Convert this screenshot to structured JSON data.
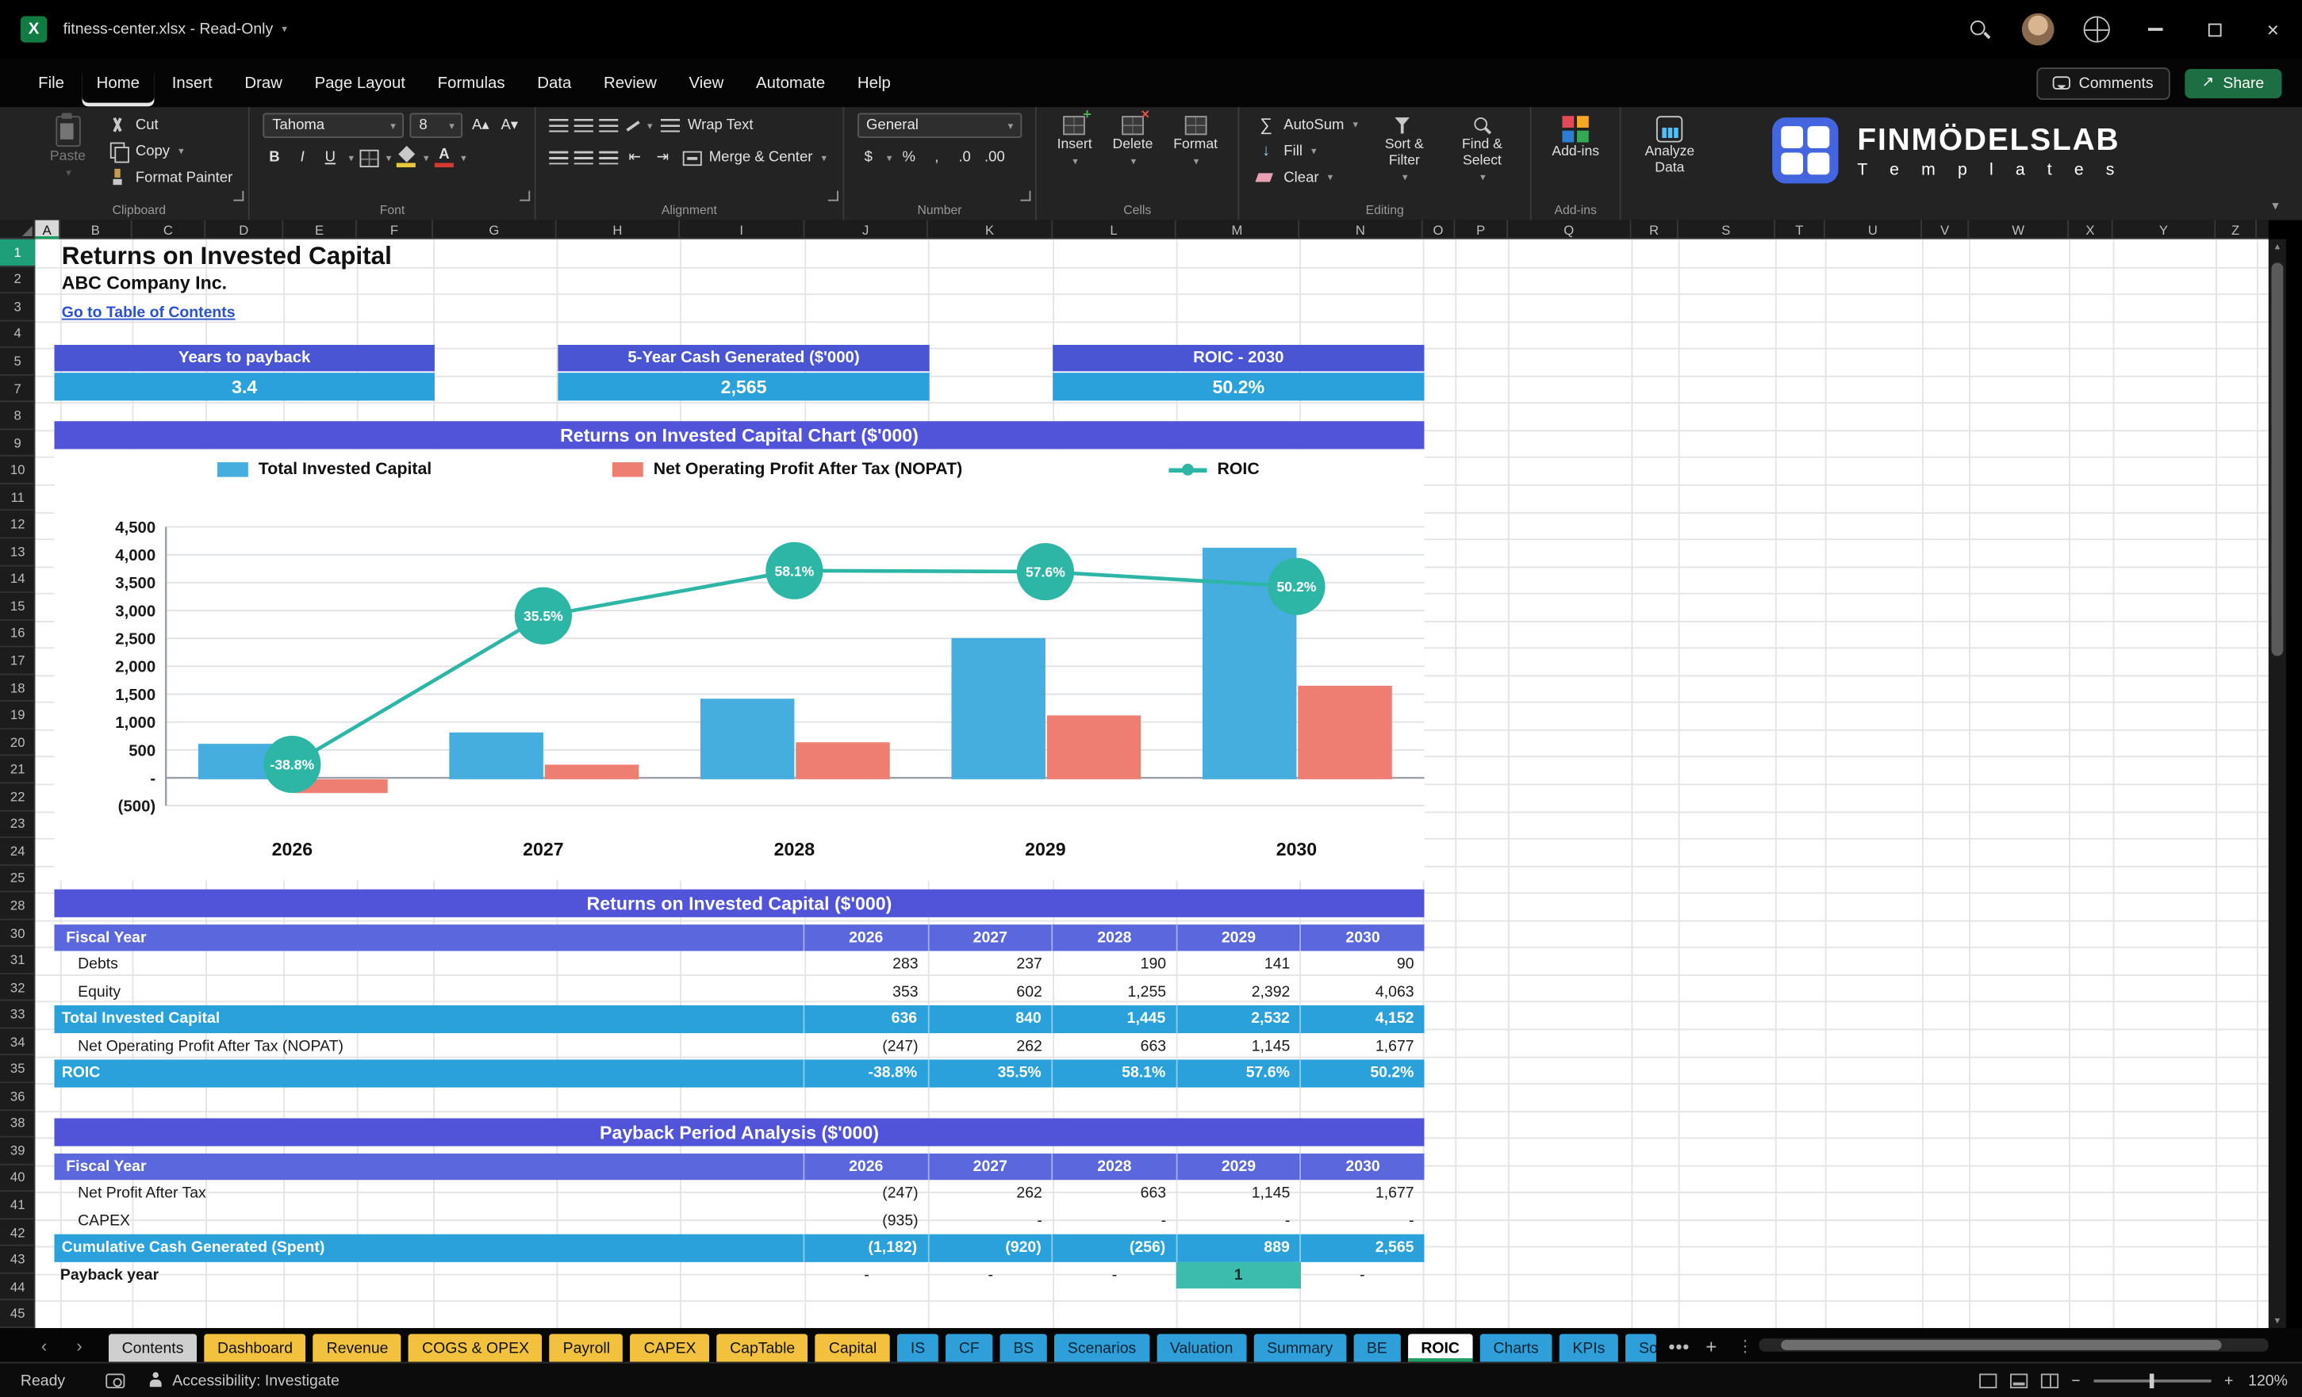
{
  "titlebar": {
    "title": "fitness-center.xlsx  -  Read-Only"
  },
  "menubar": {
    "items": [
      "File",
      "Home",
      "Insert",
      "Draw",
      "Page Layout",
      "Formulas",
      "Data",
      "Review",
      "View",
      "Automate",
      "Help"
    ],
    "active_index": 1,
    "comments": "Comments",
    "share": "Share"
  },
  "ribbon": {
    "paste": "Paste",
    "cut": "Cut",
    "copy": "Copy",
    "format_painter": "Format Painter",
    "clipboard_group": "Clipboard",
    "font_name": "Tahoma",
    "font_size": "8",
    "font_group": "Font",
    "wrap_text": "Wrap Text",
    "merge_center": "Merge & Center",
    "alignment_group": "Alignment",
    "number_format": "General",
    "number_group": "Number",
    "insert": "Insert",
    "delete": "Delete",
    "format": "Format",
    "cells_group": "Cells",
    "autosum": "AutoSum",
    "fill": "Fill",
    "clear": "Clear",
    "sort_filter": "Sort & Filter",
    "find_select": "Find & Select",
    "editing_group": "Editing",
    "addins": "Add-ins",
    "addins_group": "Add-ins",
    "analyze_data": "Analyze Data",
    "brand_line1": "FINMÖDELSLAB",
    "brand_line2": "T e m p l a t e s"
  },
  "grid": {
    "columns": [
      [
        "A",
        17
      ],
      [
        "B",
        49
      ],
      [
        "C",
        50
      ],
      [
        "D",
        53
      ],
      [
        "E",
        50
      ],
      [
        "F",
        52
      ],
      [
        "G",
        84
      ],
      [
        "H",
        84
      ],
      [
        "I",
        85
      ],
      [
        "J",
        84
      ],
      [
        "K",
        85
      ],
      [
        "L",
        84
      ],
      [
        "M",
        84
      ],
      [
        "N",
        84
      ],
      [
        "O",
        22
      ],
      [
        "P",
        36
      ],
      [
        "Q",
        84
      ],
      [
        "R",
        32
      ],
      [
        "S",
        66
      ],
      [
        "T",
        34
      ],
      [
        "U",
        66
      ],
      [
        "V",
        32
      ],
      [
        "W",
        68
      ],
      [
        "X",
        30
      ],
      [
        "Y",
        70
      ],
      [
        "Z",
        28
      ]
    ],
    "rows": [
      1,
      2,
      3,
      4,
      5,
      7,
      8,
      9,
      10,
      11,
      12,
      13,
      14,
      15,
      16,
      17,
      18,
      19,
      20,
      21,
      22,
      23,
      24,
      25,
      28,
      30,
      31,
      32,
      33,
      34,
      35,
      36,
      38,
      39,
      40,
      41,
      42,
      43,
      44,
      45
    ],
    "selected_row": "1",
    "selected_col": "A"
  },
  "sheet": {
    "title": "Returns on Invested Capital",
    "company": "ABC Company Inc.",
    "toc_link": "Go to Table of Contents",
    "kpis": [
      {
        "label": "Years to payback",
        "value": "3.4"
      },
      {
        "label": "5-Year Cash Generated ($'000)",
        "value": "2,565"
      },
      {
        "label": "ROIC - 2030",
        "value": "50.2%"
      }
    ]
  },
  "chart_data": {
    "type": "bar",
    "title": "Returns on Invested Capital Chart ($'000)",
    "categories": [
      "2026",
      "2027",
      "2028",
      "2029",
      "2030"
    ],
    "series": [
      {
        "name": "Total Invested Capital",
        "type": "bar",
        "values": [
          636,
          840,
          1445,
          2532,
          4152
        ]
      },
      {
        "name": "Net Operating Profit After Tax (NOPAT)",
        "type": "bar",
        "values": [
          -247,
          262,
          663,
          1145,
          1677
        ]
      },
      {
        "name": "ROIC",
        "type": "line",
        "values_pct": [
          -38.8,
          35.5,
          58.1,
          57.6,
          50.2
        ],
        "point_labels": [
          "-38.8%",
          "35.5%",
          "58.1%",
          "57.6%",
          "50.2%"
        ]
      }
    ],
    "y_ticks": [
      "4,500",
      "4,000",
      "3,500",
      "3,000",
      "2,500",
      "2,000",
      "1,500",
      "1,000",
      "500",
      "-",
      "(500)"
    ],
    "y_min": -500,
    "y_max": 4500,
    "grid": true,
    "legend_position": "top",
    "colors": {
      "invested": "#45AEDE",
      "nopat": "#EE7D72",
      "roic": "#2DB5A6"
    }
  },
  "roic_table": {
    "title": "Returns on Invested Capital ($'000)",
    "header": [
      "Fiscal Year",
      "2026",
      "2027",
      "2028",
      "2029",
      "2030"
    ],
    "rows": [
      {
        "label": "Debts",
        "style": "plain",
        "values": [
          "283",
          "237",
          "190",
          "141",
          "90"
        ]
      },
      {
        "label": "Equity",
        "style": "plain",
        "values": [
          "353",
          "602",
          "1,255",
          "2,392",
          "4,063"
        ]
      },
      {
        "label": "Total Invested Capital",
        "style": "highlight",
        "values": [
          "636",
          "840",
          "1,445",
          "2,532",
          "4,152"
        ]
      },
      {
        "label": "Net Operating Profit After Tax (NOPAT)",
        "style": "plain",
        "values": [
          "(247)",
          "262",
          "663",
          "1,145",
          "1,677"
        ]
      },
      {
        "label": "ROIC",
        "style": "highlight",
        "values": [
          "-38.8%",
          "35.5%",
          "58.1%",
          "57.6%",
          "50.2%"
        ]
      }
    ]
  },
  "payback_table": {
    "title": "Payback Period Analysis ($'000)",
    "header": [
      "Fiscal Year",
      "2026",
      "2027",
      "2028",
      "2029",
      "2030"
    ],
    "rows": [
      {
        "label": "Net Profit After Tax",
        "style": "plain",
        "values": [
          "(247)",
          "262",
          "663",
          "1,145",
          "1,677"
        ]
      },
      {
        "label": "CAPEX",
        "style": "plain",
        "values": [
          "(935)",
          "-",
          "-",
          "-",
          "-"
        ]
      },
      {
        "label": "Cumulative Cash Generated (Spent)",
        "style": "highlight",
        "values": [
          "(1,182)",
          "(920)",
          "(256)",
          "889",
          "2,565"
        ]
      },
      {
        "label": "Payback year",
        "style": "payback",
        "values": [
          "-",
          "-",
          "-",
          "1",
          "-"
        ],
        "highlight_cell": 3
      }
    ]
  },
  "tabs": {
    "items": [
      {
        "label": "Contents",
        "color": "plain"
      },
      {
        "label": "Dashboard",
        "color": "yellow"
      },
      {
        "label": "Revenue",
        "color": "yellow"
      },
      {
        "label": "COGS & OPEX",
        "color": "yellow"
      },
      {
        "label": "Payroll",
        "color": "yellow"
      },
      {
        "label": "CAPEX",
        "color": "yellow"
      },
      {
        "label": "CapTable",
        "color": "yellow"
      },
      {
        "label": "Capital",
        "color": "yellow"
      },
      {
        "label": "IS",
        "color": "blue"
      },
      {
        "label": "CF",
        "color": "blue"
      },
      {
        "label": "BS",
        "color": "blue"
      },
      {
        "label": "Scenarios",
        "color": "blue"
      },
      {
        "label": "Valuation",
        "color": "blue"
      },
      {
        "label": "Summary",
        "color": "blue"
      },
      {
        "label": "BE",
        "color": "blue"
      },
      {
        "label": "ROIC",
        "color": "active"
      },
      {
        "label": "Charts",
        "color": "blue"
      },
      {
        "label": "KPIs",
        "color": "blue"
      },
      {
        "label": "So",
        "color": "blue",
        "cut": true
      }
    ],
    "more_label": "●●●",
    "add_label": "+"
  },
  "statusbar": {
    "ready": "Ready",
    "accessibility": "Accessibility: Investigate",
    "zoom": "120%",
    "zoom_minus": "−",
    "zoom_plus": "+"
  }
}
